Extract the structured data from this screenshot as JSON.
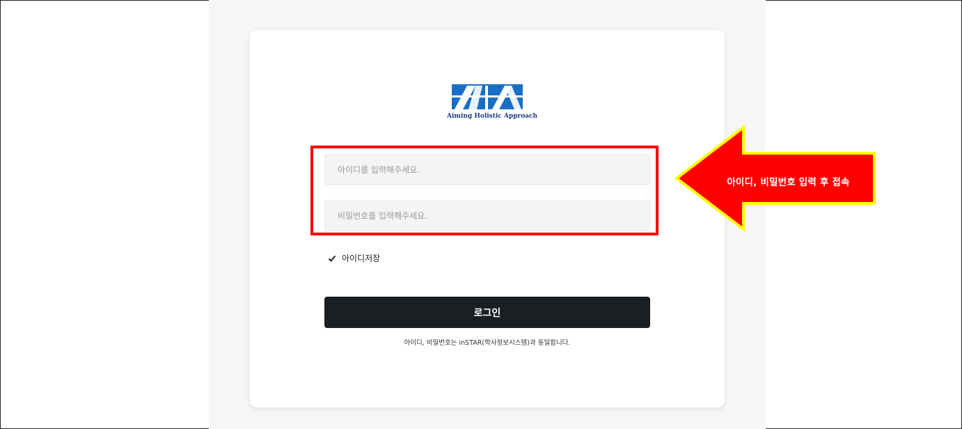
{
  "logo": {
    "tagline": "Aiming Holistic Approach"
  },
  "login_form": {
    "id_placeholder": "아이디를 입력해주세요.",
    "password_placeholder": "비밀번호를 입력해주세요.",
    "remember_label": "아이디저장",
    "remember_checked": true,
    "login_button_label": "로그인",
    "notice": "아이디, 비밀번호는 inSTAR(학사정보시스템)과 동일합니다."
  },
  "annotation": {
    "callout_text": "아이디, 비밀번호 입력 후 접속",
    "arrow_color": "#ff0000",
    "arrow_outline_color": "#ffff00",
    "highlight_color": "#ff0000"
  },
  "colors": {
    "button_bg": "#1b1e22",
    "logo_blue": "#1a6fc4"
  }
}
